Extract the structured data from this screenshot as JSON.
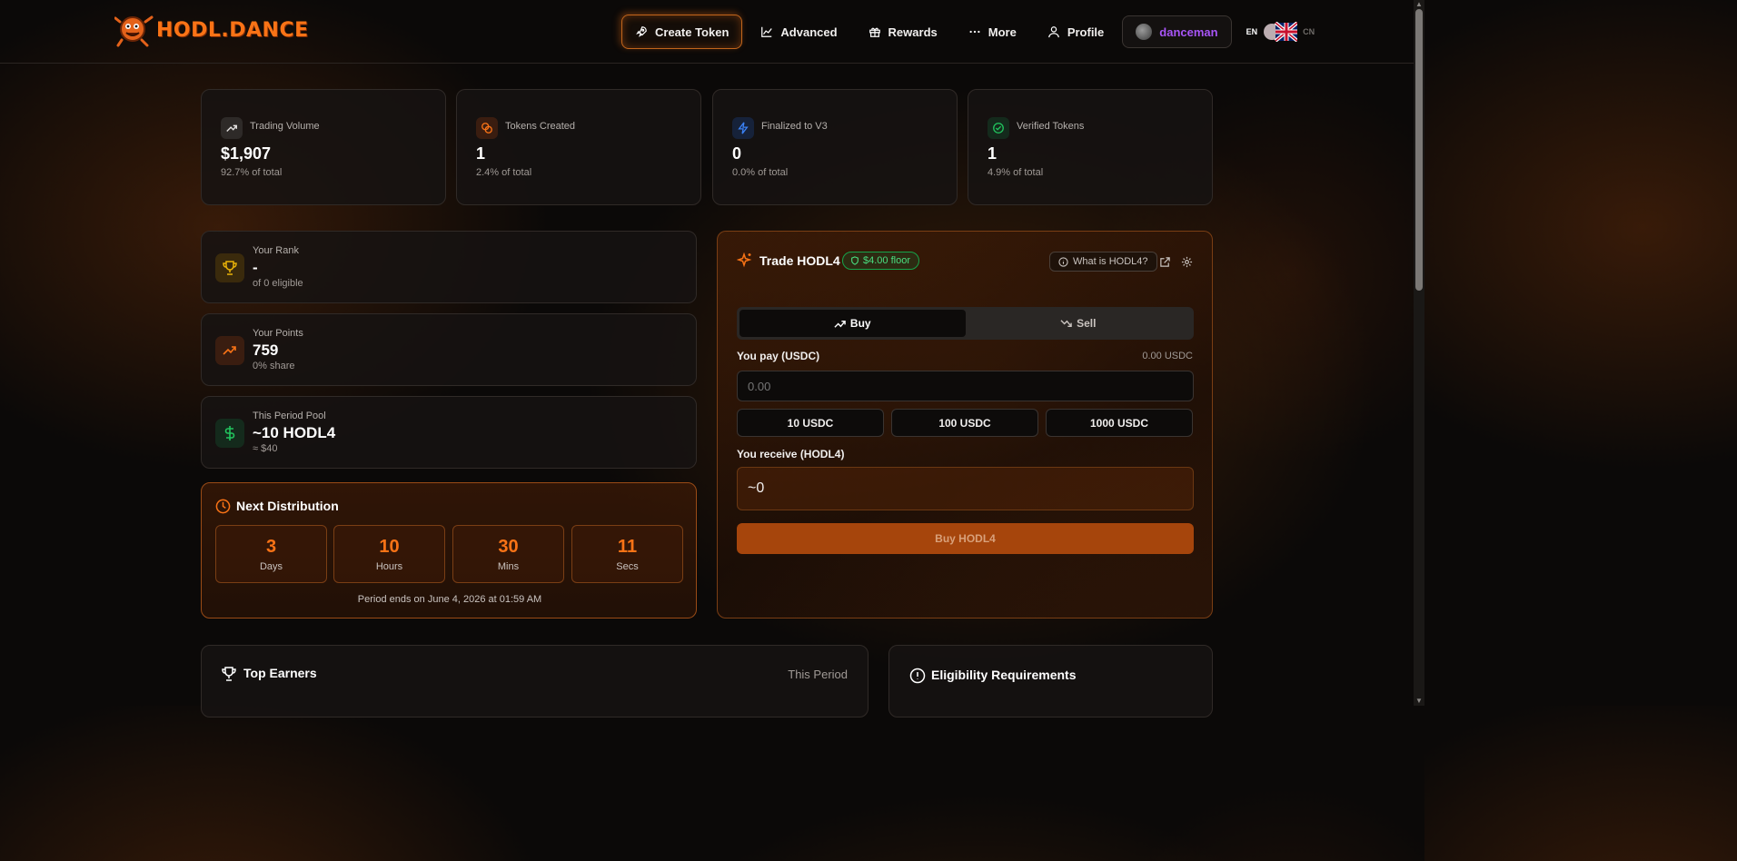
{
  "header": {
    "logo_text": "HODL.DANCE",
    "nav": {
      "create_token": "Create Token",
      "advanced": "Advanced",
      "rewards": "Rewards",
      "more": "More",
      "profile": "Profile"
    },
    "username": "danceman",
    "lang_en": "EN",
    "lang_cn": "CN"
  },
  "stats": [
    {
      "label": "Trading Volume",
      "value": "$1,907",
      "sub": "92.7% of total"
    },
    {
      "label": "Tokens Created",
      "value": "1",
      "sub": "2.4% of total"
    },
    {
      "label": "Finalized to V3",
      "value": "0",
      "sub": "0.0% of total"
    },
    {
      "label": "Verified Tokens",
      "value": "1",
      "sub": "4.9% of total"
    }
  ],
  "rank": {
    "label": "Your Rank",
    "value": "-",
    "sub": "of 0 eligible"
  },
  "points": {
    "label": "Your Points",
    "value": "759",
    "sub": "0% share"
  },
  "pool": {
    "label": "This Period Pool",
    "value": "~10 HODL4",
    "sub": "≈ $40"
  },
  "distribution": {
    "title": "Next Distribution",
    "days": "3",
    "days_label": "Days",
    "hours": "10",
    "hours_label": "Hours",
    "mins": "30",
    "mins_label": "Mins",
    "secs": "11",
    "secs_label": "Secs",
    "ends": "Period ends on June 4, 2026 at 01:59 AM"
  },
  "trade": {
    "title": "Trade HODL4",
    "floor_badge": "$4.00 floor",
    "what_is": "What is HODL4?",
    "tab_buy": "Buy",
    "tab_sell": "Sell",
    "pay_label": "You pay (USDC)",
    "pay_balance": "0.00 USDC",
    "pay_placeholder": "0.00",
    "quick": [
      "10 USDC",
      "100 USDC",
      "1000 USDC"
    ],
    "receive_label": "You receive (HODL4)",
    "receive_value": "~0",
    "buy_button": "Buy HODL4"
  },
  "top_earners": {
    "title": "Top Earners",
    "period": "This Period"
  },
  "eligibility": {
    "title": "Eligibility Requirements"
  },
  "colors": {
    "accent": "#f97316",
    "success": "#4ade80",
    "username": "#a855f7"
  }
}
